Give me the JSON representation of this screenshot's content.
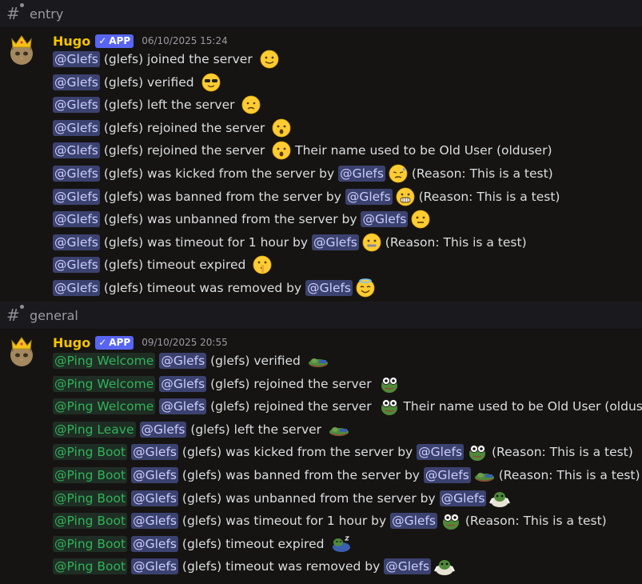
{
  "channels": [
    {
      "name": "entry",
      "message": {
        "author": "Hugo",
        "badge": "APP",
        "timestamp": "06/10/2025 15:24",
        "lines": [
          {
            "mention": "@Glefs",
            "text": "(glefs) joined the server",
            "emoji": "slightly-smiling-face"
          },
          {
            "mention": "@Glefs",
            "text": "(glefs) verified",
            "emoji": "sunglasses-face"
          },
          {
            "mention": "@Glefs",
            "text": "(glefs) left the server",
            "emoji": "frowning-face"
          },
          {
            "mention": "@Glefs",
            "text": "(glefs) rejoined the server",
            "emoji": "open-mouth-face"
          },
          {
            "mention": "@Glefs",
            "text": "(glefs) rejoined the server",
            "emoji": "open-mouth-face",
            "after": "Their name used to be Old User (olduser)"
          },
          {
            "mention": "@Glefs",
            "text": "(glefs) was kicked from the server by",
            "mention2": "@Glefs",
            "emoji": "downcast-sweat-face",
            "after": "(Reason: This is a test)"
          },
          {
            "mention": "@Glefs",
            "text": "(glefs) was banned from the server by",
            "mention2": "@Glefs",
            "emoji": "grimacing-face",
            "after": "(Reason: This is a test)"
          },
          {
            "mention": "@Glefs",
            "text": "(glefs) was unbanned from the server by",
            "mention2": "@Glefs",
            "emoji": "neutral-face"
          },
          {
            "mention": "@Glefs",
            "text": "(glefs) was timeout for 1 hour by",
            "mention2": "@Glefs",
            "emoji": "zipper-mouth-face",
            "after": "(Reason: This is a test)"
          },
          {
            "mention": "@Glefs",
            "text": "(glefs) timeout expired",
            "emoji": "shushing-face"
          },
          {
            "mention": "@Glefs",
            "text": "(glefs) timeout was removed by",
            "mention2": "@Glefs",
            "emoji": "halo-face"
          }
        ]
      }
    },
    {
      "name": "general",
      "message": {
        "author": "Hugo",
        "badge": "APP",
        "timestamp": "09/10/2025 20:55",
        "lines": [
          {
            "role": "@Ping Welcome",
            "mention": "@Glefs",
            "text": "(glefs) verified",
            "emoji": "pepe-lying"
          },
          {
            "role": "@Ping Welcome",
            "mention": "@Glefs",
            "text": "(glefs) rejoined the server",
            "emoji": "pepe-eyes"
          },
          {
            "role": "@Ping Welcome",
            "mention": "@Glefs",
            "text": "(glefs) rejoined the server",
            "emoji": "pepe-eyes",
            "after": "Their name used to be Old User (olduser)"
          },
          {
            "role": "@Ping Leave",
            "mention": "@Glefs",
            "text": "(glefs) left the server",
            "emoji": "pepe-lying"
          },
          {
            "role": "@Ping Boot",
            "mention": "@Glefs",
            "text": "(glefs) was kicked from the server by",
            "mention2": "@Glefs",
            "emoji": "pepe-eyes",
            "after": "(Reason: This is a test)"
          },
          {
            "role": "@Ping Boot",
            "mention": "@Glefs",
            "text": "(glefs) was banned from the server by",
            "mention2": "@Glefs",
            "emoji": "pepe-lying",
            "after": "(Reason: This is a test)"
          },
          {
            "role": "@Ping Boot",
            "mention": "@Glefs",
            "text": "(glefs) was unbanned from the server by",
            "mention2": "@Glefs",
            "emoji": "pepe-angel"
          },
          {
            "role": "@Ping Boot",
            "mention": "@Glefs",
            "text": "(glefs) was timeout for 1 hour by",
            "mention2": "@Glefs",
            "emoji": "pepe-eyes",
            "after": "(Reason: This is a test)"
          },
          {
            "role": "@Ping Boot",
            "mention": "@Glefs",
            "text": "(glefs) timeout expired",
            "emoji": "pepe-sleep"
          },
          {
            "role": "@Ping Boot",
            "mention": "@Glefs",
            "text": "(glefs) timeout was removed by",
            "mention2": "@Glefs",
            "emoji": "pepe-angel"
          }
        ]
      }
    }
  ],
  "colors": {
    "author": "#f5c400",
    "badge": "#5865f2",
    "mention_bg": "#3c4270",
    "role_mention": "#2fb35a"
  }
}
